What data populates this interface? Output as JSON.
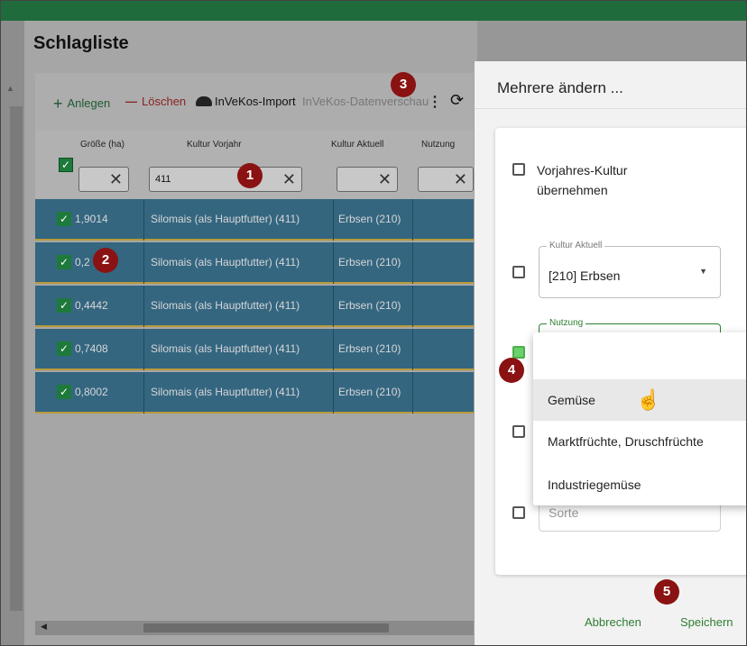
{
  "page": {
    "title": "Schlagliste"
  },
  "toolbar": {
    "add_label": "Anlegen",
    "delete_label": "Löschen",
    "import_label": "InVeKos-Import",
    "datenv_label": "InVeKos-Datenverschau",
    "icons": {
      "add": "plus-icon",
      "delete": "minus-icon",
      "import": "cloud-upload-icon",
      "more": "more-vert-icon",
      "sync": "sync-icon"
    }
  },
  "grid": {
    "columns": [
      "Größe (ha)",
      "Kultur Vorjahr",
      "Kultur Aktuell",
      "Nutzung"
    ],
    "filters": {
      "kultur_vorjahr": "411"
    },
    "rows": [
      {
        "size": "1,9014",
        "vorjahr": "Silomais (als Hauptfutter) (411)",
        "aktuell": "Erbsen (210)"
      },
      {
        "size": "0,2",
        "vorjahr": "Silomais (als Hauptfutter) (411)",
        "aktuell": "Erbsen (210)"
      },
      {
        "size": "0,4442",
        "vorjahr": "Silomais (als Hauptfutter) (411)",
        "aktuell": "Erbsen (210)"
      },
      {
        "size": "0,7408",
        "vorjahr": "Silomais (als Hauptfutter) (411)",
        "aktuell": "Erbsen (210)"
      },
      {
        "size": "0,8002",
        "vorjahr": "Silomais (als Hauptfutter) (411)",
        "aktuell": "Erbsen (210)"
      }
    ]
  },
  "panel": {
    "title": "Mehrere ändern ...",
    "vorjahr_option": "Vorjahres-Kultur übernehmen",
    "kultur_aktuell": {
      "label": "Kultur Aktuell",
      "value": "[210] Erbsen"
    },
    "nutzung": {
      "label": "Nutzung"
    },
    "sorte_placeholder": "Sorte",
    "cancel_label": "Abbrechen",
    "save_label": "Speichern"
  },
  "dropdown": {
    "options": [
      "Gemüse",
      "Marktfrüchte, Druschfrüchte",
      "Industriegemüse"
    ],
    "hovered": "Gemüse"
  },
  "badges": [
    "1",
    "2",
    "3",
    "4",
    "5"
  ],
  "colors": {
    "topbar": "#1f6b3c",
    "row_selected": "#346680",
    "accent_green": "#2e7d32",
    "badge": "#8b1212"
  }
}
